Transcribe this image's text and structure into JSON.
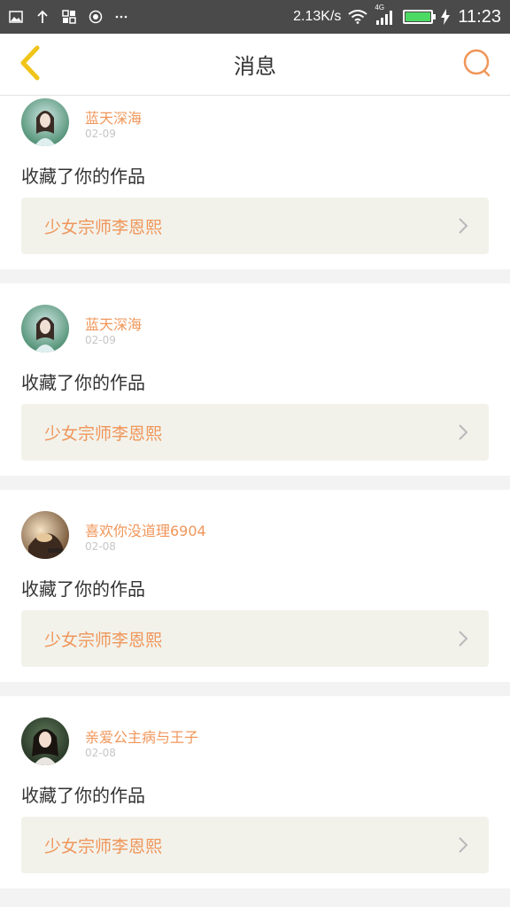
{
  "status_bar": {
    "network_speed": "2.13K/s",
    "signal_type": "4G",
    "time": "11:23",
    "battery_level": 1.0,
    "icons": [
      "image-icon",
      "upload-icon",
      "apps-icon",
      "record-icon",
      "more-dots-icon",
      "wifi-icon",
      "signal-icon",
      "battery-icon",
      "charging-icon"
    ]
  },
  "nav": {
    "title": "消息",
    "back_icon": "chevron-left-icon",
    "search_icon": "search-icon",
    "accent_color": "#f0c419",
    "search_color": "#f0965a"
  },
  "messages": [
    {
      "user": "蓝天深海",
      "date": "02-09",
      "action": "收藏了你的作品",
      "work": "少女宗师李恩熙",
      "avatar": "avatar-teal-forest"
    },
    {
      "user": "蓝天深海",
      "date": "02-09",
      "action": "收藏了你的作品",
      "work": "少女宗师李恩熙",
      "avatar": "avatar-teal-forest"
    },
    {
      "user": "喜欢你没道理6904",
      "date": "02-08",
      "action": "收藏了你的作品",
      "work": "少女宗师李恩熙",
      "avatar": "avatar-warm-sepia"
    },
    {
      "user": "亲爱公主病与王子",
      "date": "02-08",
      "action": "收藏了你的作品",
      "work": "少女宗师李恩熙",
      "avatar": "avatar-dark-portrait"
    }
  ]
}
